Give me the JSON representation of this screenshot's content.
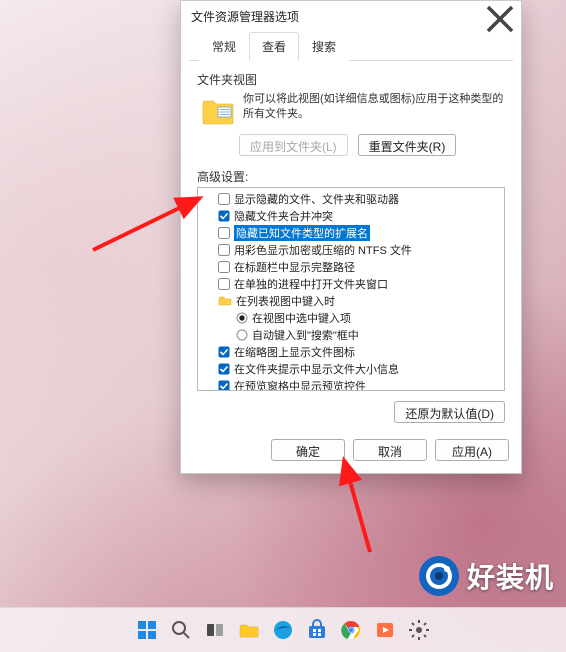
{
  "dialog": {
    "title": "文件资源管理器选项",
    "tabs": [
      {
        "label": "常规",
        "active": false
      },
      {
        "label": "查看",
        "active": true
      },
      {
        "label": "搜索",
        "active": false
      }
    ],
    "folder_view": {
      "heading": "文件夹视图",
      "description": "你可以将此视图(如详细信息或图标)应用于这种类型的所有文件夹。",
      "apply_btn": "应用到文件夹(L)",
      "reset_btn": "重置文件夹(R)"
    },
    "advanced": {
      "heading": "高级设置:",
      "items": [
        {
          "kind": "checkbox",
          "checked": false,
          "label": "显示隐藏的文件、文件夹和驱动器",
          "indent": 0
        },
        {
          "kind": "checkbox",
          "checked": true,
          "label": "隐藏文件夹合并冲突",
          "indent": 0
        },
        {
          "kind": "checkbox",
          "checked": false,
          "label": "隐藏已知文件类型的扩展名",
          "indent": 0,
          "selected": true
        },
        {
          "kind": "checkbox",
          "checked": false,
          "label": "用彩色显示加密或压缩的 NTFS 文件",
          "indent": 0
        },
        {
          "kind": "checkbox",
          "checked": false,
          "label": "在标题栏中显示完整路径",
          "indent": 0
        },
        {
          "kind": "checkbox",
          "checked": false,
          "label": "在单独的进程中打开文件夹窗口",
          "indent": 0
        },
        {
          "kind": "folder",
          "label": "在列表视图中键入时",
          "indent": 0
        },
        {
          "kind": "radio",
          "checked": true,
          "label": "在视图中选中键入项",
          "indent": 1
        },
        {
          "kind": "radio",
          "checked": false,
          "label": "自动键入到\"搜索\"框中",
          "indent": 1
        },
        {
          "kind": "checkbox",
          "checked": true,
          "label": "在缩略图上显示文件图标",
          "indent": 0
        },
        {
          "kind": "checkbox",
          "checked": true,
          "label": "在文件夹提示中显示文件大小信息",
          "indent": 0
        },
        {
          "kind": "checkbox",
          "checked": true,
          "label": "在预览窗格中显示预览控件",
          "indent": 0
        }
      ],
      "restore_btn": "还原为默认值(D)"
    },
    "footer": {
      "ok": "确定",
      "cancel": "取消",
      "apply": "应用(A)"
    }
  },
  "brand_text": "好装机",
  "taskbar": {
    "icons": [
      "start",
      "search",
      "taskview",
      "explorer",
      "edge",
      "store",
      "chrome",
      "folder2",
      "settings"
    ]
  }
}
